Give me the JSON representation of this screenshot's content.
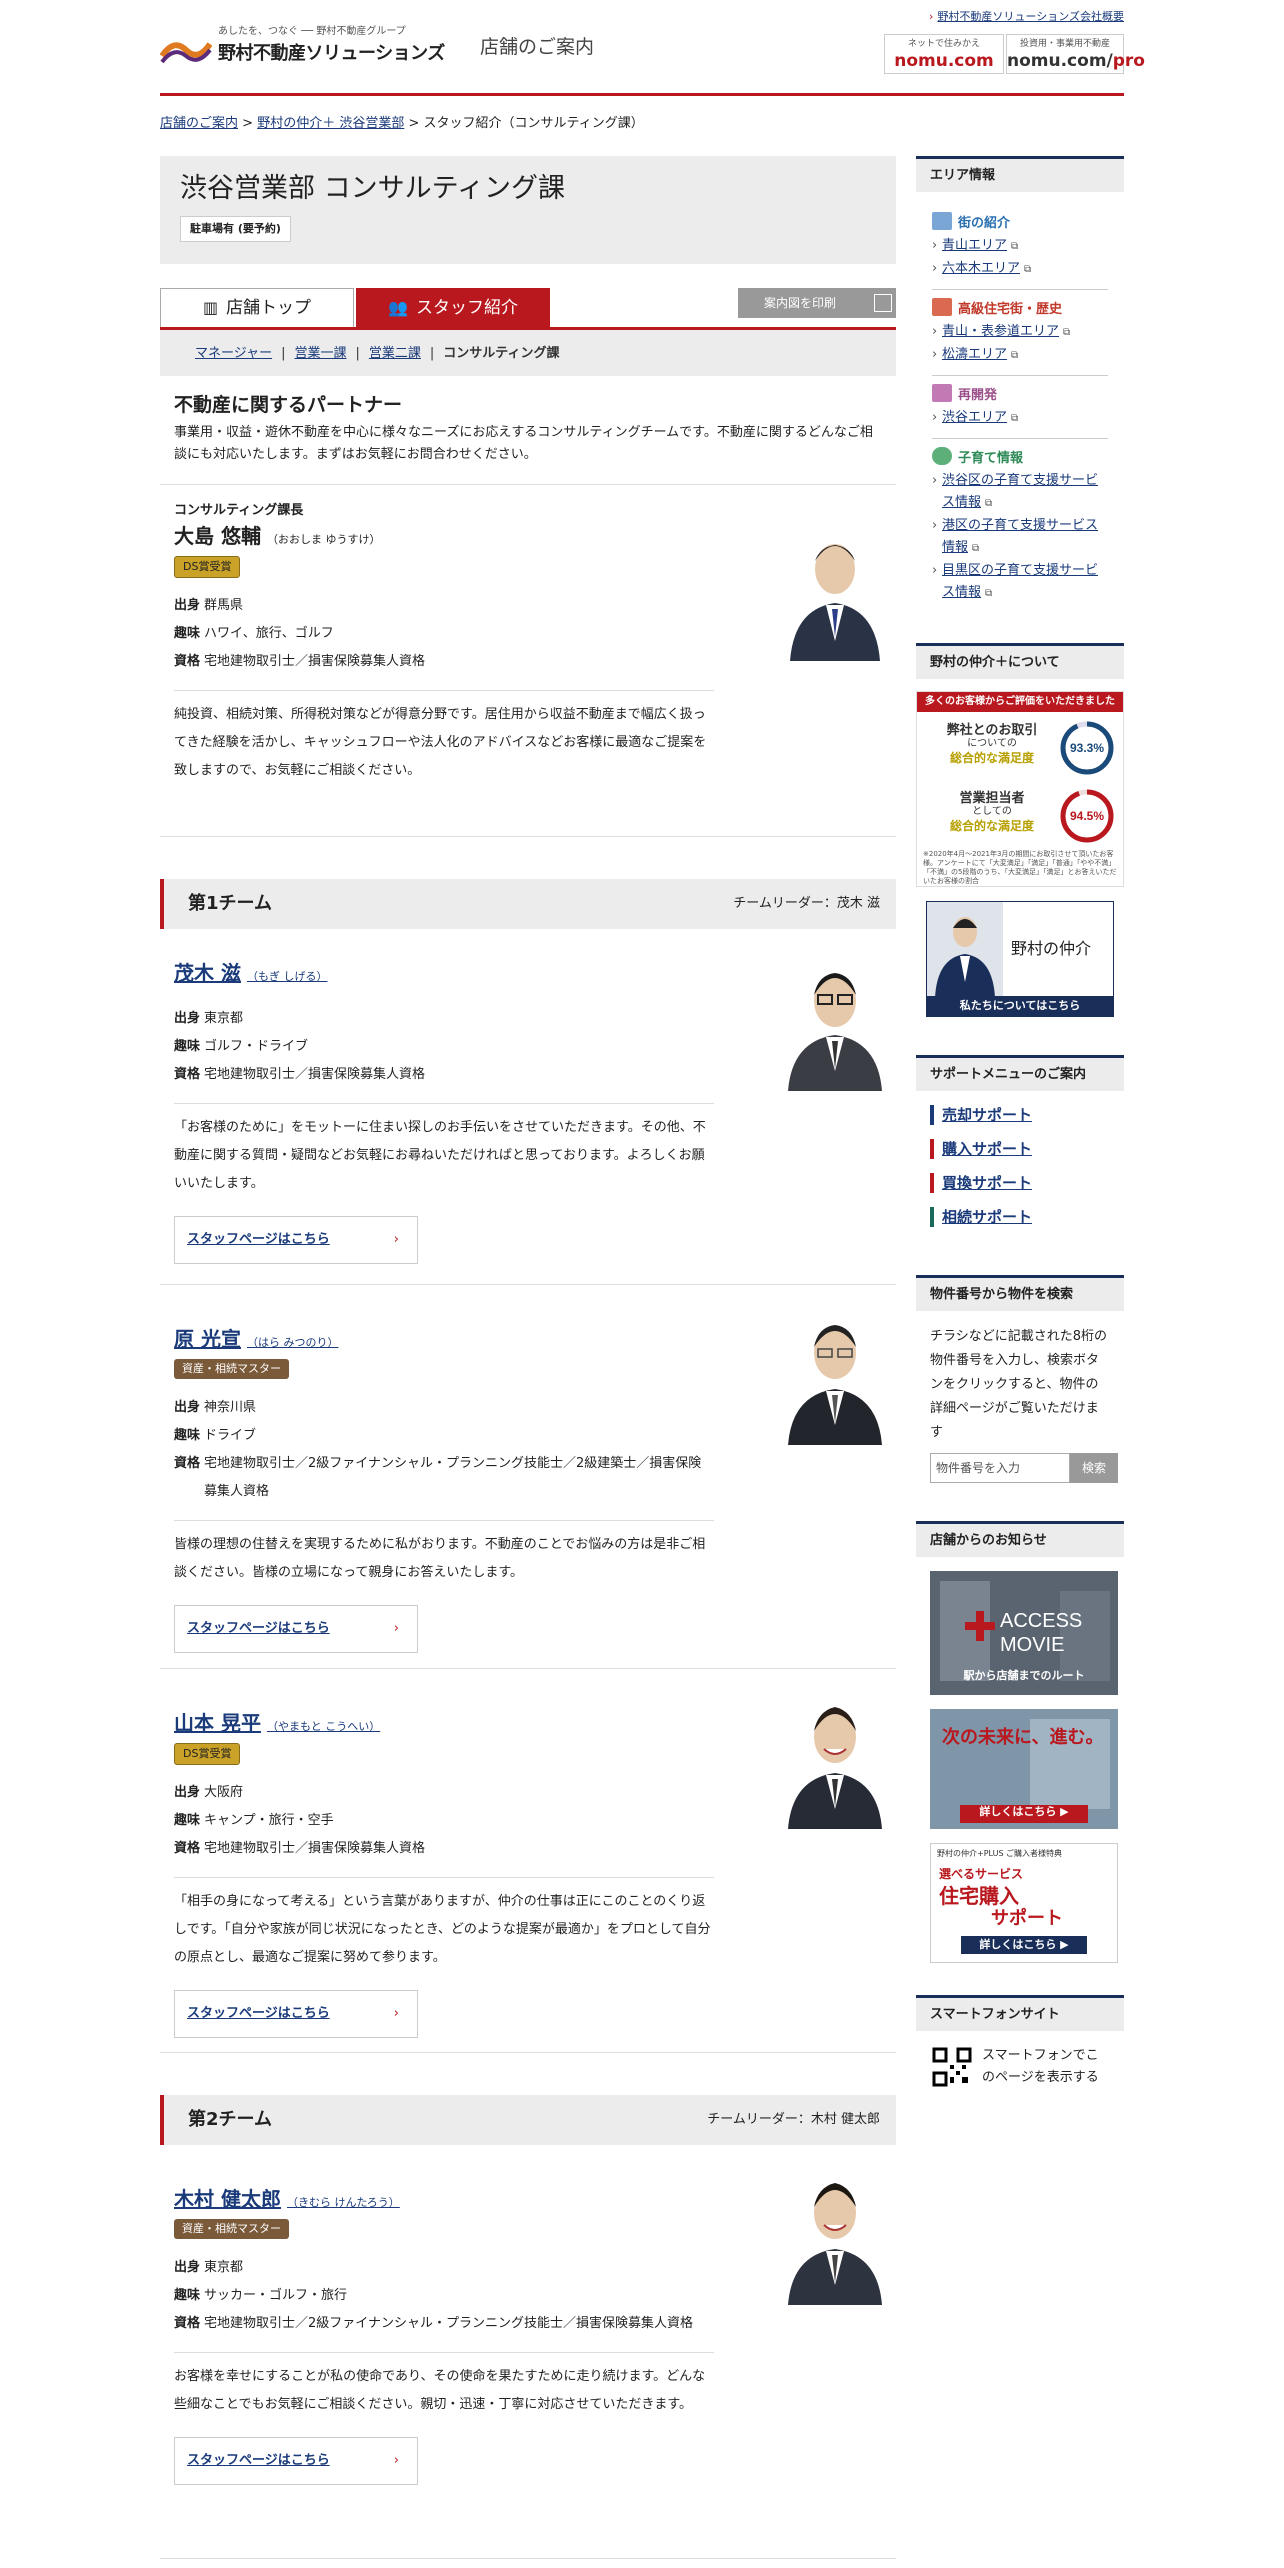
{
  "header": {
    "logo_tagline": "あしたを、つなぐ ── 野村不動産グループ",
    "logo_name": "野村不動産ソリューションズ",
    "store_guide": "店舗のご案内",
    "corp_link": "野村不動産ソリューションズ会社概要",
    "nomu_small": "ネットで住みかえ",
    "nomu_big": "nomu.com",
    "pro_small": "投資用・事業用不動産",
    "pro_big_a": "nomu.com/",
    "pro_big_b": "pro"
  },
  "breadcrumb": {
    "item1": "店舗のご案内",
    "item2": "野村の仲介＋ 渋谷営業部",
    "current": "スタッフ紹介（コンサルティング課）"
  },
  "store": {
    "title": "渋谷営業部 コンサルティング課",
    "parking": "駐車場有 (要予約)"
  },
  "tabs": {
    "top": "店舗トップ",
    "staff": "スタッフ紹介",
    "print": "案内図を印刷"
  },
  "subnav": {
    "manager": "マネージャー",
    "sales1": "営業一課",
    "sales2": "営業二課",
    "consulting": "コンサルティング課"
  },
  "partner": {
    "title": "不動産に関するパートナー",
    "text": "事業用・収益・遊休不動産を中心に様々なニーズにお応えするコンサルティングチームです。不動産に関するどんなご相談にも対応いたします。まずはお気軽にお問合わせください。"
  },
  "labels": {
    "origin": "出身",
    "hobby": "趣味",
    "license": "資格",
    "staff_page": "スタッフページはこちら"
  },
  "chief": {
    "role": "コンサルティング課長",
    "name": "大島 悠輔",
    "kana": "（おおしま ゆうすけ）",
    "badge": "DS賞受賞",
    "origin": "群馬県",
    "hobby": "ハワイ、旅行、ゴルフ",
    "license": "宅地建物取引士／損害保険募集人資格",
    "desc": "純投資、相続対策、所得税対策などが得意分野です。居住用から収益不動産まで幅広く扱ってきた経験を活かし、キャッシュフローや法人化のアドバイスなどお客様に最適なご提案を致しますので、お気軽にご相談ください。"
  },
  "team1": {
    "name": "第1チーム",
    "leader": "チームリーダー：茂木 滋"
  },
  "staff1": {
    "name": "茂木 滋",
    "kana": "（もぎ しげる）",
    "origin": "東京都",
    "hobby": "ゴルフ・ドライブ",
    "license": "宅地建物取引士／損害保険募集人資格",
    "desc": "「お客様のために」をモットーに住まい探しのお手伝いをさせていただきます。その他、不動産に関する質問・疑問などお気軽にお尋ねいただければと思っております。よろしくお願いいたします。"
  },
  "staff2": {
    "name": "原 光宣",
    "kana": "（はら みつのり）",
    "badge": "資産・相続マスター",
    "origin": "神奈川県",
    "hobby": "ドライブ",
    "license": "宅地建物取引士／2級ファイナンシャル・プランニング技能士／2級建築士／損害保険募集人資格",
    "desc": "皆様の理想の住替えを実現するために私がおります。不動産のことでお悩みの方は是非ご相談ください。皆様の立場になって親身にお答えいたします。"
  },
  "staff3": {
    "name": "山本 晃平",
    "kana": "（やまもと こうへい）",
    "badge": "DS賞受賞",
    "origin": "大阪府",
    "hobby": "キャンプ・旅行・空手",
    "license": "宅地建物取引士／損害保険募集人資格",
    "desc": "「相手の身になって考える」という言葉がありますが、仲介の仕事は正にこのことのくり返しです。「自分や家族が同じ状況になったとき、どのような提案が最適か」をプロとして自分の原点とし、最適なご提案に努めて参ります。"
  },
  "team2": {
    "name": "第2チーム",
    "leader": "チームリーダー：木村 健太郎"
  },
  "staff4": {
    "name": "木村 健太郎",
    "kana": "（きむら けんたろう）",
    "badge": "資産・相続マスター",
    "origin": "東京都",
    "hobby": "サッカー・ゴルフ・旅行",
    "license": "宅地建物取引士／2級ファイナンシャル・プランニング技能士／損害保険募集人資格",
    "desc": "お客様を幸せにすることが私の使命であり、その使命を果たすために走り続けます。どんな些細なことでもお気軽にご相談ください。親切・迅速・丁寧に対応させていただきます。"
  },
  "sidebar": {
    "area_title": "エリア情報",
    "cat_town": "街の紹介",
    "town1": "青山エリア",
    "town2": "六本木エリア",
    "cat_luxury": "高級住宅街・歴史",
    "lux1": "青山・表参道エリア",
    "lux2": "松濤エリア",
    "cat_redev": "再開発",
    "redev1": "渋谷エリア",
    "cat_child": "子育て情報",
    "child1": "渋谷区の子育て支援サービス情報",
    "child2": "港区の子育て支援サービス情報",
    "child3": "目黒区の子育て支援サービス情報",
    "about_title": "野村の仲介＋について",
    "sat_top": "多くのお客様からご評価をいただきました",
    "sat1_a": "弊社とのお取引",
    "sat1_b": "についての",
    "sat1_c": "総合的な満足度",
    "sat1_val": "93.3%",
    "sat2_a": "営業担当者",
    "sat2_b": "としての",
    "sat2_c": "総合的な満足度",
    "sat2_val": "94.5%",
    "sat_note": "※2020年4月〜2021年3月の期間にお取引させて頂いたお客様。アンケートにて「大変満足」「満足」「普通」「やや不満」「不満」の5段階のうち、「大変満足」「満足」とお答えいただいたお客様の割合",
    "banner_text": "野村の仲介",
    "banner_foot": "私たちについてはこちら",
    "support_title": "サポートメニューのご案内",
    "sup1": "売却サポート",
    "sup2": "購入サポート",
    "sup3": "買換サポート",
    "sup4": "相続サポート",
    "search_title": "物件番号から物件を検索",
    "search_text": "チラシなどに記載された8桁の物件番号を入力し、検索ボタンをクリックすると、物件の詳細ページがご覧いただけます",
    "search_placeholder": "物件番号を入力",
    "search_button": "検索",
    "news_title": "店舗からのお知らせ",
    "access_a": "ACCESS",
    "access_b": "MOVIE",
    "access_cap": "駅から店舗までのルート",
    "next_text": "次の未来に、進む。",
    "next_cap": "詳しくはこちら ▶",
    "sel_small": "野村の仲介+PLUS ご購入者様特典",
    "sel_a": "選べるサービス",
    "sel_b": "住宅購入",
    "sel_c": "サポート",
    "sel_cap": "詳しくはこちら ▶",
    "sp_title": "スマートフォンサイト",
    "sp_text": "スマートフォンでこのページを表示する"
  },
  "colors": {
    "brand_red": "#b8181e",
    "navy": "#1a2e5a",
    "gray_bg": "#ececec"
  }
}
